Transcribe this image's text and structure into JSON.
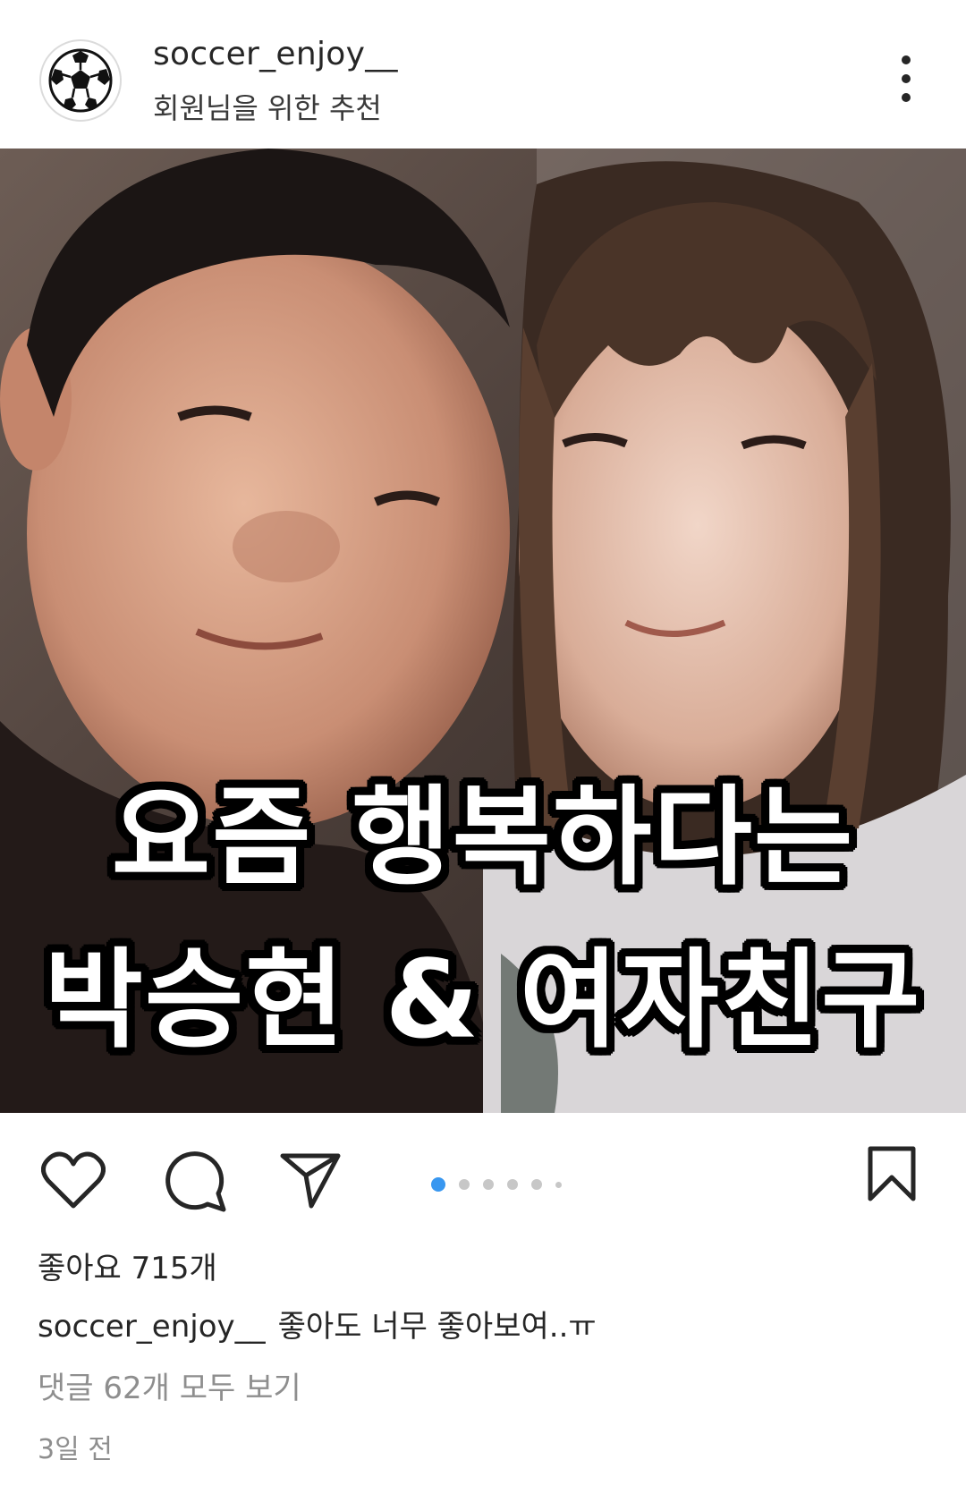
{
  "post": {
    "username": "soccer_enjoy__",
    "subtitle": "회원님을 위한 추천",
    "image_caption_line1": "요즘 행복하다는",
    "image_caption_line2": "박승현 & 여자친구",
    "likes_text": "좋아요 715개",
    "caption_username": "soccer_enjoy__",
    "caption_text": "좋아도 너무 좋아보여..ㅠ",
    "view_comments": "댓글 62개 모두 보기",
    "time_ago": "3일 전",
    "carousel_count": 6,
    "carousel_active_index": 0
  },
  "icons": {
    "avatar": "soccer-ball-icon",
    "more": "more-vertical-icon",
    "like": "heart-outline-icon",
    "comment": "comment-bubble-icon",
    "share": "paper-plane-icon",
    "save": "bookmark-outline-icon"
  },
  "colors": {
    "accent": "#3897f0",
    "text": "#262626",
    "muted": "#8e8e8e",
    "dot_inactive": "#c7c7c7"
  }
}
